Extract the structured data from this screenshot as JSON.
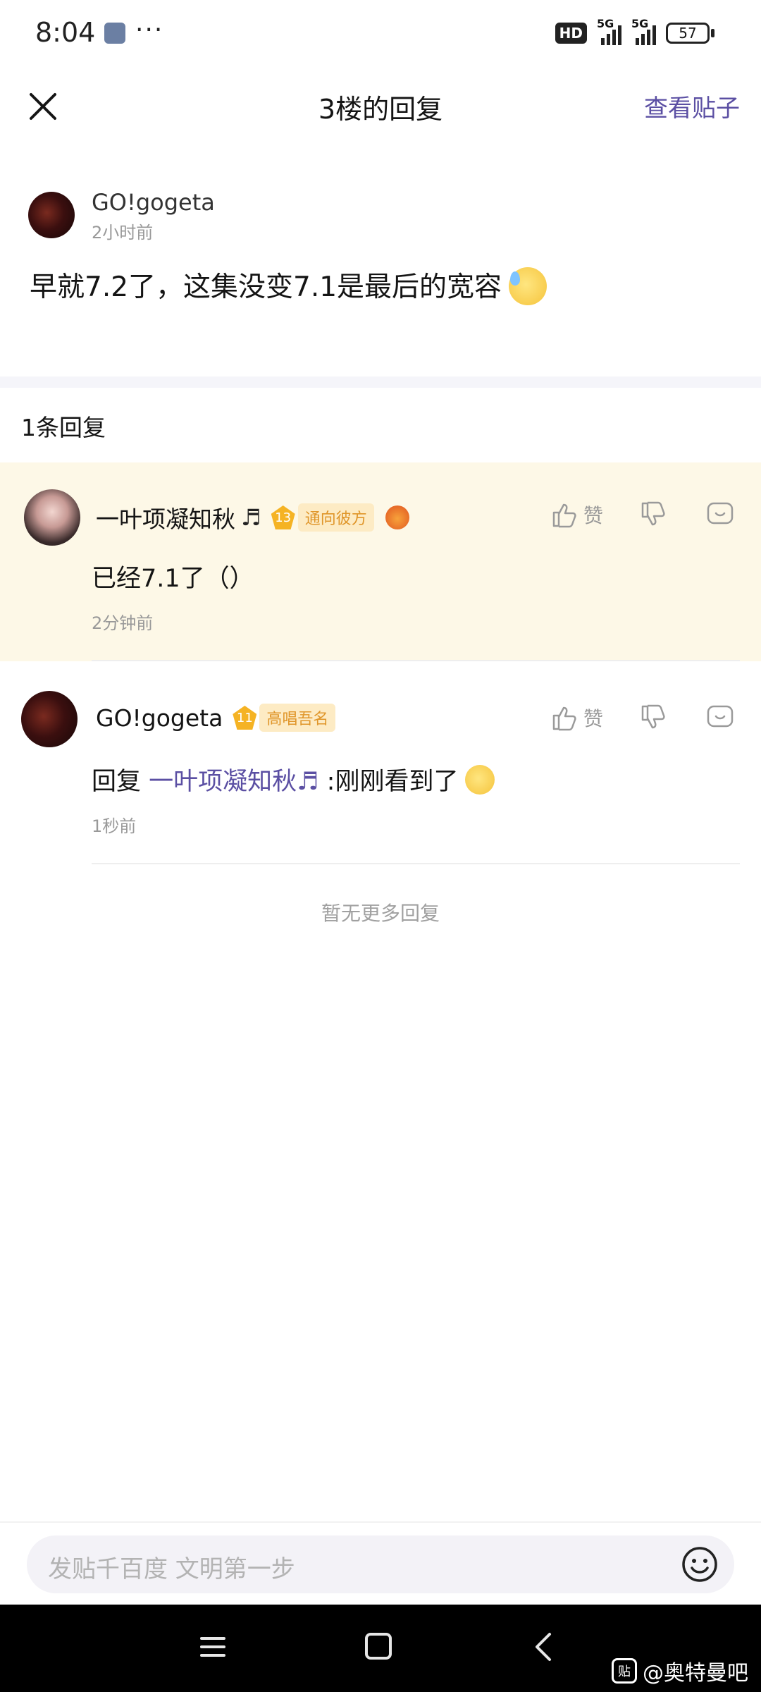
{
  "status_bar": {
    "time": "8:04",
    "dots": "···",
    "hd": "HD",
    "sim1": "5G",
    "sim2": "5G",
    "battery": "57"
  },
  "header": {
    "title": "3楼的回复",
    "view_post": "查看贴子",
    "close_icon": "close-icon"
  },
  "main_post": {
    "username": "GO!gogeta",
    "time": "2小时前",
    "content": "早就7.2了，这集没变7.1是最后的宽容"
  },
  "reply_count": "1条回复",
  "replies": [
    {
      "username": "一叶项凝知秋",
      "level": "13",
      "tag": "通向彼方",
      "content": "已经7.1了（）",
      "time": "2分钟前",
      "like_label": "赞"
    },
    {
      "username": "GO!gogeta",
      "level": "11",
      "tag": "高唱吾名",
      "content_prefix": "回复 ",
      "mention": "一叶项凝知秋",
      "content_suffix": " :刚刚看到了",
      "time": "1秒前",
      "like_label": "赞"
    }
  ],
  "no_more": "暂无更多回复",
  "input": {
    "placeholder": "发贴千百度 文明第一步"
  },
  "watermark": {
    "badge": "贴",
    "text": "@奥特曼吧"
  },
  "colors": {
    "accent": "#5b4fa3",
    "highlight_bg": "#fdf8e7",
    "level_badge": "#f5b324",
    "tag_text": "#e0962a"
  }
}
